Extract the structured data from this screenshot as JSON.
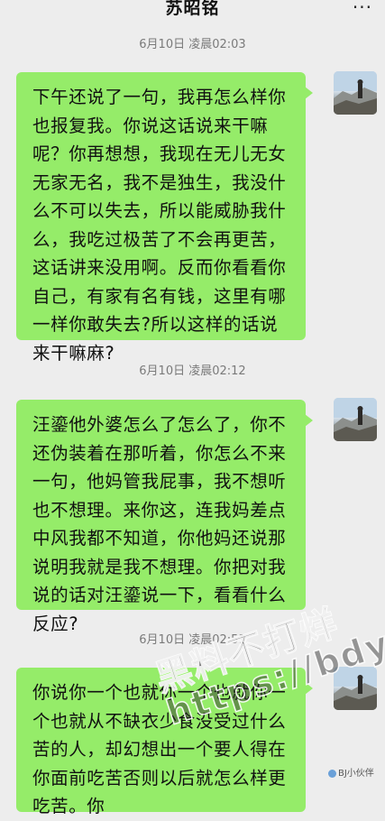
{
  "header": {
    "title": "苏昭铭",
    "more_label": "···"
  },
  "messages": [
    {
      "timestamp": "6月10日 凌晨02:03",
      "text": "下午还说了一句，我再怎么样你也报复我。你说这话说来干嘛呢？你再想想，我现在无儿无女无家无名，我不是独生，我没什么不可以失去，所以能威胁我什么，我吃过极苦了不会再更苦，这话讲来没用啊。反而你看看你自己，有家有名有钱，这里有哪一样你敢失去?所以这样的话说来干嘛麻?"
    },
    {
      "timestamp": "6月10日 凌晨02:12",
      "text": "汪鎏他外婆怎么了怎么了，你不还伪装着在那听着，你怎么不来一句，他妈管我屁事，我不想听也不想理。来你这，连我妈差点中风我都不知道，你他妈还说那说明我就是我不想理。你把对我说的话对汪鎏说一下，看看什么反应?"
    },
    {
      "timestamp": "6月10日 凌晨02:51",
      "text": "你说你一个也就你一个也就你一个也就从不缺衣少食没受过什么苦的人，却幻想出一个要人得在你面前吃苦否则以后就怎么样更吃苦。你"
    }
  ],
  "watermark": {
    "line1": "黑料不打烊",
    "line2": "https://bdy5.co"
  },
  "credit": "BJ小伙伴",
  "colors": {
    "bubble": "#95ec69",
    "background": "#ededed"
  }
}
